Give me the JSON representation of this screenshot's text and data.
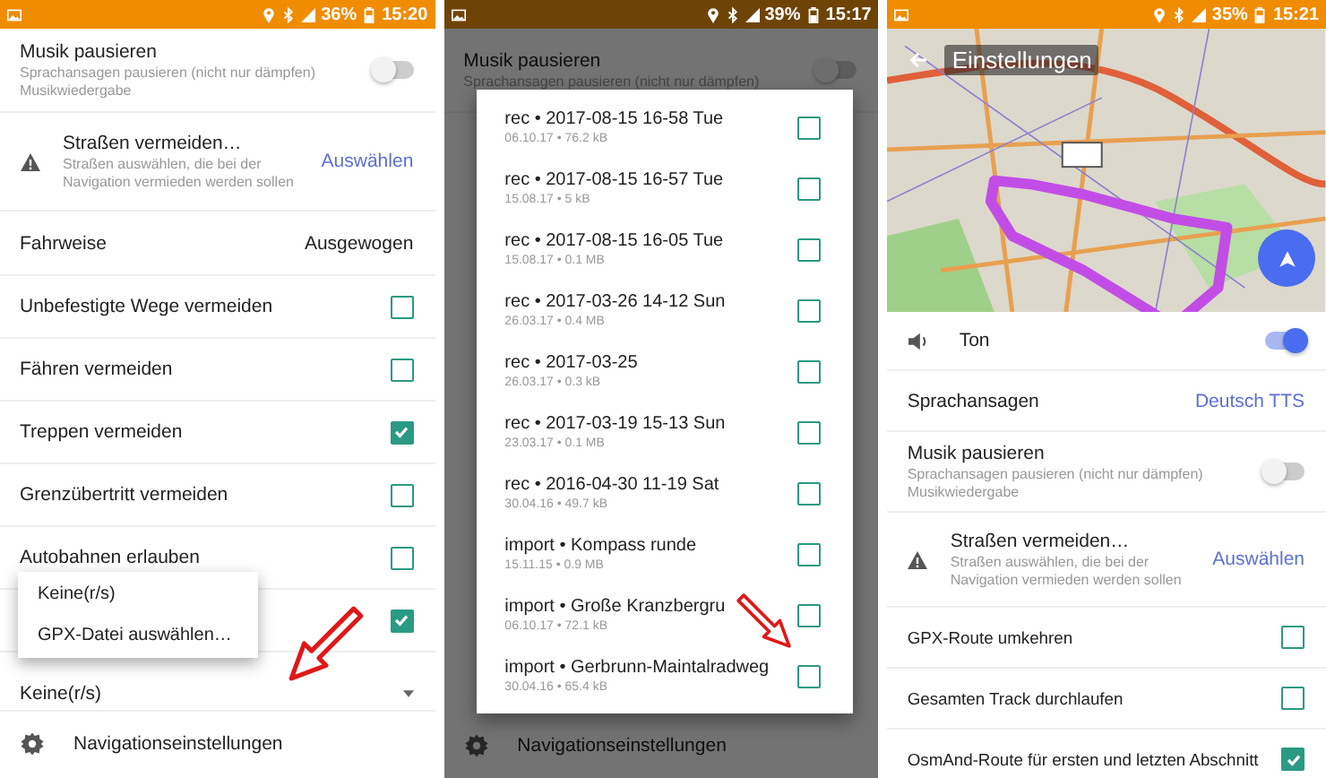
{
  "panels": [
    {
      "dimmed": false,
      "status_bar": {
        "battery": "36%",
        "time": "15:20"
      },
      "rows": [
        {
          "kind": "toggle",
          "title": "Musik pausieren",
          "subtitle": "Sprachansagen pausieren (nicht nur dämpfen) Musikwiedergabe",
          "on": false
        },
        {
          "kind": "action",
          "title": "Straßen vermeiden…",
          "subtitle": "Straßen auswählen, die bei der Navigation vermieden werden sollen",
          "action": "Auswählen"
        },
        {
          "kind": "value",
          "label": "Fahrweise",
          "value": "Ausgewogen",
          "link": false
        },
        {
          "kind": "checkbox",
          "label": "Unbefestigte Wege vermeiden",
          "checked": false
        },
        {
          "kind": "checkbox",
          "label": "Fähren vermeiden",
          "checked": false
        },
        {
          "kind": "checkbox",
          "label": "Treppen vermeiden",
          "checked": true
        },
        {
          "kind": "checkbox",
          "label": "Grenzübertritt vermeiden",
          "checked": false
        },
        {
          "kind": "checkbox",
          "label": "Autobahnen erlauben",
          "checked": false
        },
        {
          "kind": "checkbox",
          "checked": true
        },
        {
          "kind": "dropdown",
          "value": "Keine(r/s)"
        },
        {
          "kind": "nav",
          "label": "Navigationseinstellungen"
        }
      ],
      "popup_menu": [
        "Keine(r/s)",
        "GPX-Datei auswählen…"
      ],
      "annotation_arrow": true
    },
    {
      "dimmed": true,
      "status_bar": {
        "battery": "39%",
        "time": "15:17"
      },
      "rows": [
        {
          "kind": "toggle",
          "title": "Musik pausieren",
          "subtitle": "Sprachansagen pausieren (nicht nur dämpfen)",
          "on": false
        },
        {
          "kind": "spacer"
        },
        {
          "kind": "nav",
          "label": "Navigationseinstellungen"
        }
      ],
      "dialog": [
        {
          "title": "rec • 2017-08-15 16-58 Tue",
          "meta": "06.10.17 • 76.2 kB",
          "checked": false
        },
        {
          "title": "rec • 2017-08-15 16-57 Tue",
          "meta": "15.08.17 • 5 kB",
          "checked": false
        },
        {
          "title": "rec • 2017-08-15 16-05 Tue",
          "meta": "15.08.17 • 0.1 MB",
          "checked": false
        },
        {
          "title": "rec • 2017-03-26 14-12 Sun",
          "meta": "26.03.17 • 0.4 MB",
          "checked": false
        },
        {
          "title": "rec • 2017-03-25",
          "meta": "26.03.17 • 0.3 kB",
          "checked": false
        },
        {
          "title": "rec • 2017-03-19 15-13 Sun",
          "meta": "23.03.17 • 0.1 MB",
          "checked": false
        },
        {
          "title": "rec • 2016-04-30 11-19 Sat",
          "meta": "30.04.16 • 49.7 kB",
          "checked": false
        },
        {
          "title": "import • Kompass runde",
          "meta": "15.11.15 • 0.9 MB",
          "checked": false
        },
        {
          "title": "import • Große Kranzbergru",
          "meta": "06.10.17 • 72.1 kB",
          "checked": false
        },
        {
          "title": "import • Gerbrunn-Maintalradweg",
          "meta": "30.04.16 • 65.4 kB",
          "checked": false
        }
      ],
      "annotation_arrow": true
    },
    {
      "dimmed": false,
      "status_bar": {
        "battery": "35%",
        "time": "15:21"
      },
      "map": {
        "title": "Einstellungen"
      },
      "rows": [
        {
          "kind": "sound",
          "label": "Ton",
          "on": true
        },
        {
          "kind": "value",
          "label": "Sprachansagen",
          "value": "Deutsch TTS",
          "link": true
        },
        {
          "kind": "toggle",
          "title": "Musik pausieren",
          "subtitle": "Sprachansagen pausieren (nicht nur dämpfen) Musikwiedergabe",
          "on": false
        },
        {
          "kind": "action",
          "title": "Straßen vermeiden…",
          "subtitle": "Straßen auswählen, die bei der Navigation vermieden werden sollen",
          "action": "Auswählen"
        },
        {
          "kind": "checkbox",
          "label": "GPX-Route umkehren",
          "checked": false
        },
        {
          "kind": "checkbox",
          "label": "Gesamten Track durchlaufen",
          "checked": false
        },
        {
          "kind": "checkbox",
          "label": "OsmAnd-Route für ersten und letzten Abschnitt",
          "checked": true
        }
      ]
    }
  ]
}
